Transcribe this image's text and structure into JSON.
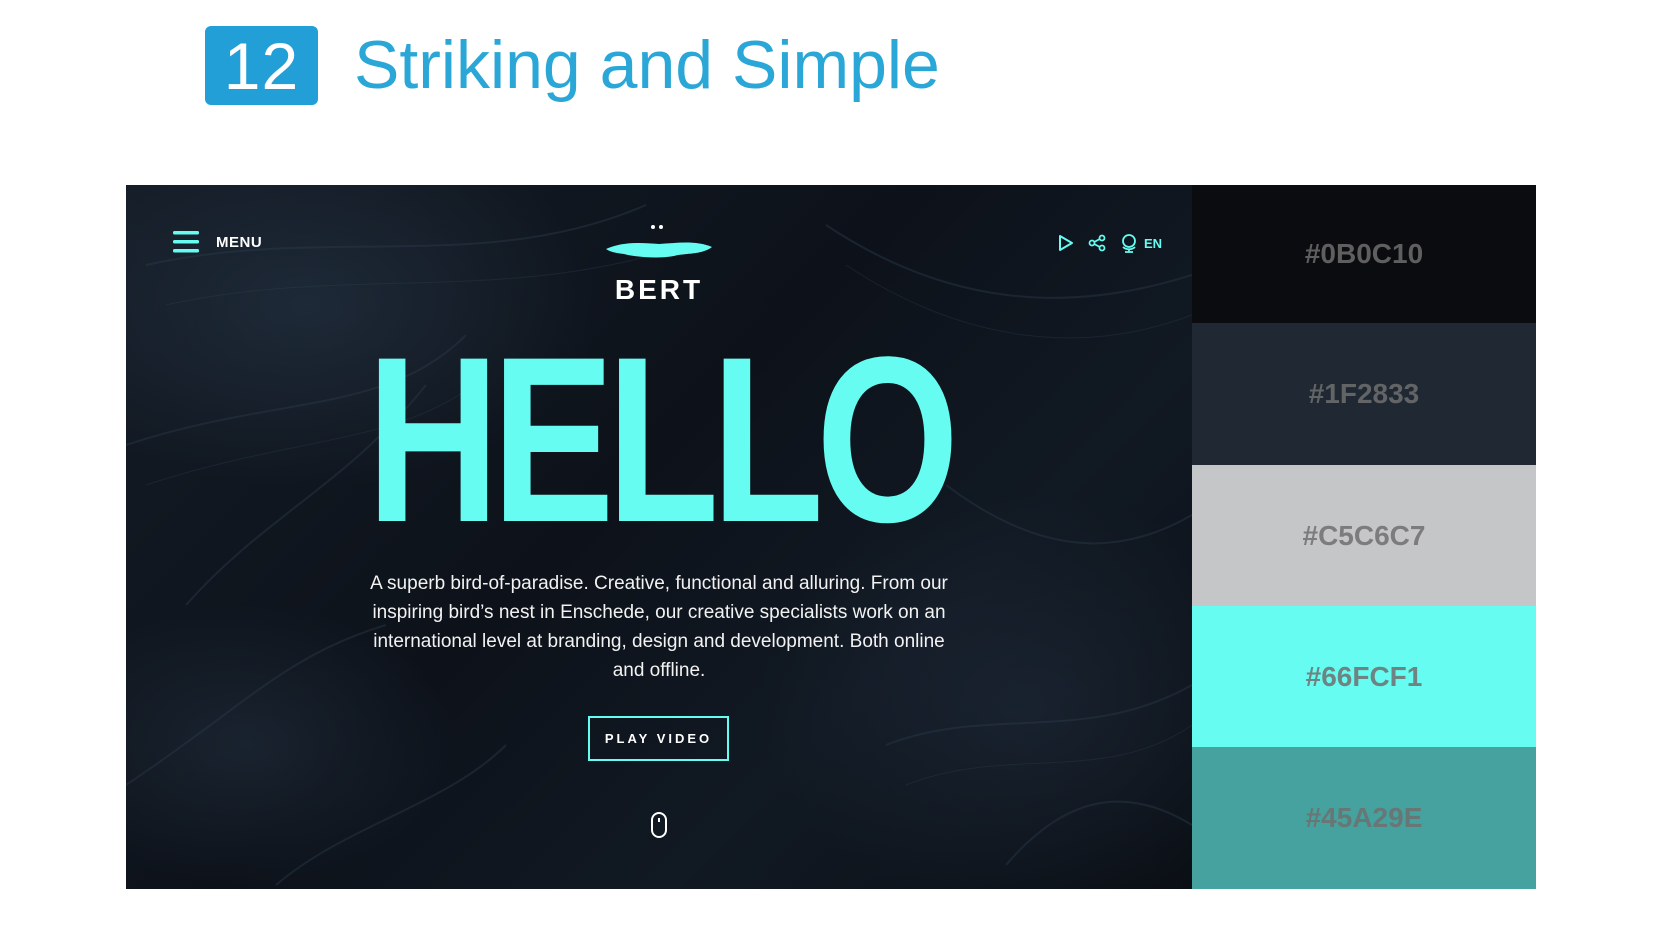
{
  "header": {
    "number": "12",
    "title": "Striking and Simple",
    "badge_color": "#229FD6",
    "title_color": "#2AA7D6"
  },
  "site": {
    "menu_label": "MENU",
    "logo_text": "BERT",
    "language": "EN",
    "hero_title": "HELLO",
    "intro_text": "A superb bird-of-paradise. Creative, functional and alluring. From our inspiring bird’s nest in Enschede, our creative specialists work on an international level at branding, design and development. Both online and offline.",
    "cta_label": "PLAY VIDEO",
    "icons": [
      "hamburger-menu-icon",
      "play-icon",
      "share-icon",
      "globe-icon",
      "mouse-scroll-icon",
      "bird-logo-icon"
    ]
  },
  "palette": {
    "swatches": [
      {
        "hex": "#0B0C10",
        "color": "#0B0C10"
      },
      {
        "hex": "#1F2833",
        "color": "#1F2833"
      },
      {
        "hex": "#C5C6C7",
        "color": "#C5C6C7"
      },
      {
        "hex": "#66FCF1",
        "color": "#66FCF1"
      },
      {
        "hex": "#45A29E",
        "color": "#45A29E"
      }
    ]
  }
}
